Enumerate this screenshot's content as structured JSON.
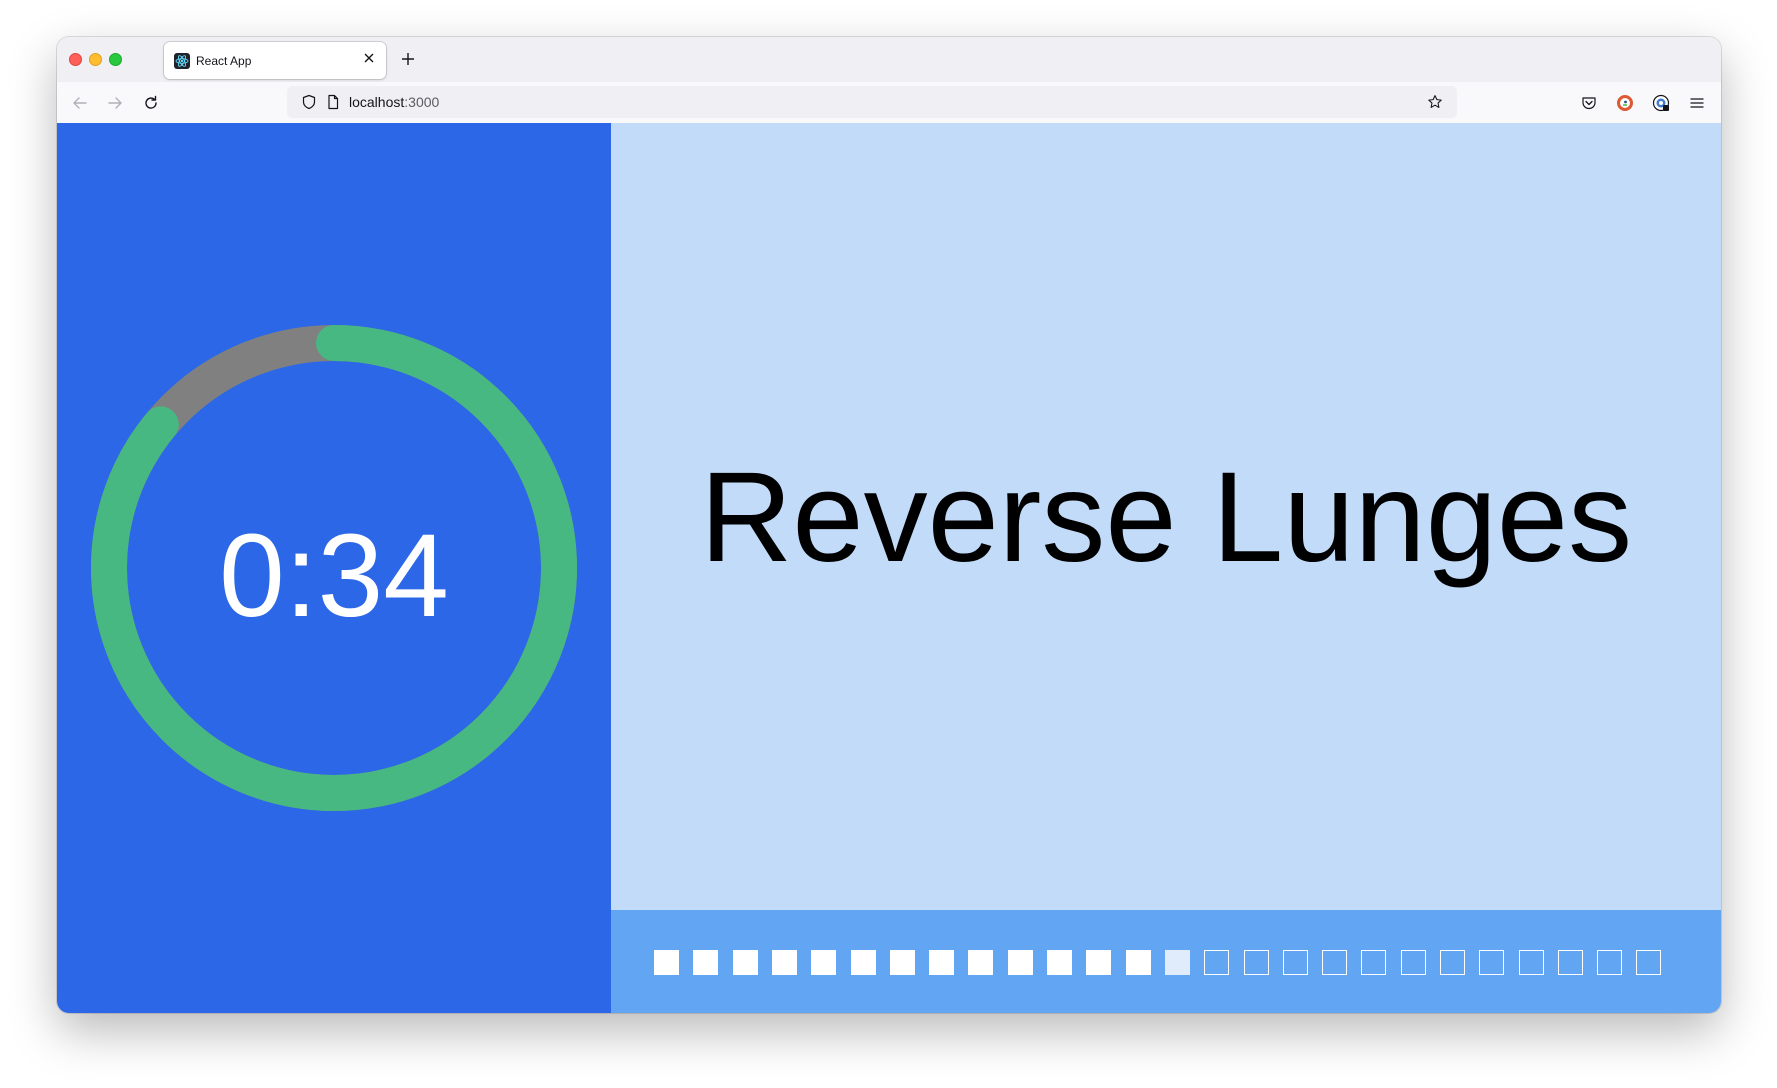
{
  "browser": {
    "tab": {
      "title": "React App",
      "favicon": "react-icon"
    },
    "url": {
      "host": "localhost",
      "port": ":3000"
    },
    "icons": [
      "back-icon",
      "forward-icon",
      "reload-icon",
      "shield-icon",
      "page-icon",
      "star-icon",
      "pocket-icon",
      "duckduckgo-icon",
      "extension-icon",
      "menu-icon"
    ]
  },
  "workout": {
    "timer": {
      "display": "0:34",
      "progress_fraction": 0.86,
      "colors": {
        "progress": "#48b882",
        "track": "#808080",
        "background": "#2b67e6"
      }
    },
    "exercise": {
      "name": "Reverse Lunges"
    },
    "sets": {
      "total": 26,
      "completed": 13,
      "current_index": 13
    }
  }
}
